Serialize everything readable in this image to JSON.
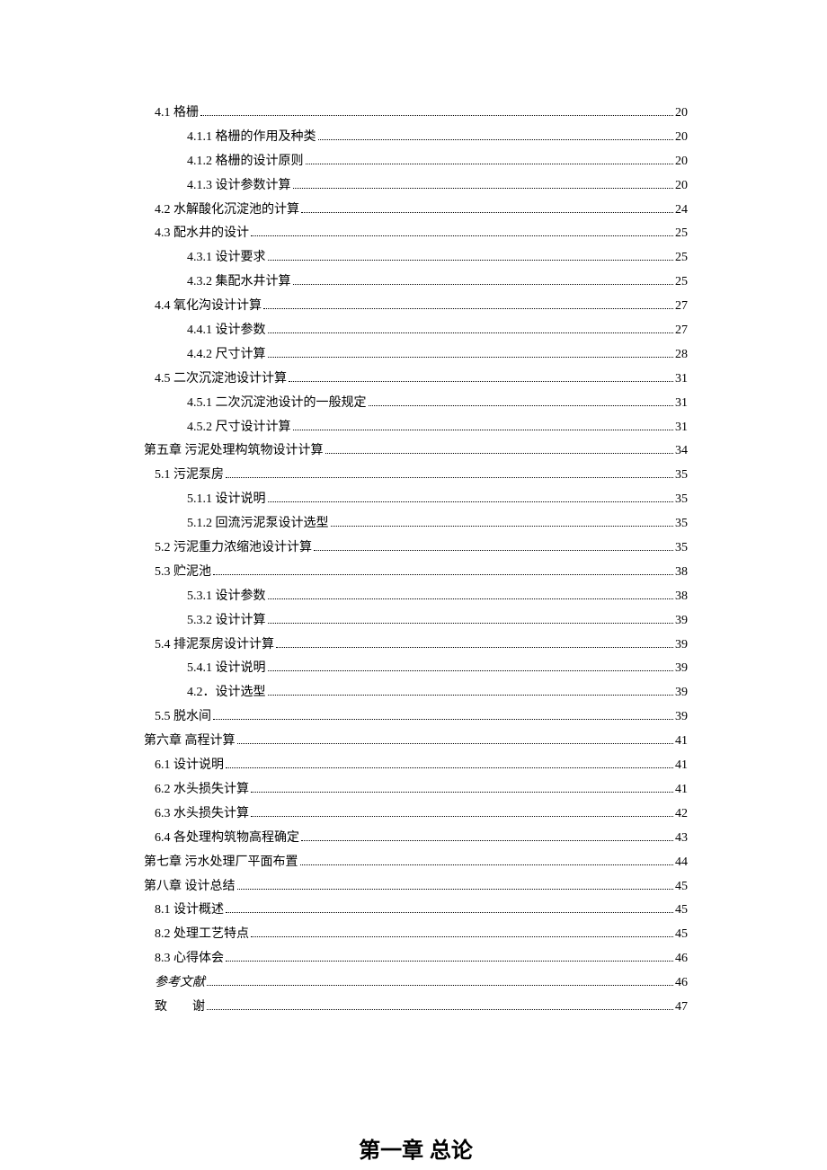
{
  "toc": [
    {
      "level": "l2",
      "label": "4.1 格栅",
      "page": "20"
    },
    {
      "level": "l3",
      "label": "4.1.1 格栅的作用及种类",
      "page": "20"
    },
    {
      "level": "l3",
      "label": "4.1.2 格栅的设计原则",
      "page": "20"
    },
    {
      "level": "l3",
      "label": "4.1.3 设计参数计算",
      "page": "20"
    },
    {
      "level": "l2",
      "label": "4.2 水解酸化沉淀池的计算",
      "page": "24"
    },
    {
      "level": "l2",
      "label": "4.3 配水井的设计",
      "page": "25"
    },
    {
      "level": "l3",
      "label": "4.3.1   设计要求",
      "page": "25"
    },
    {
      "level": "l3",
      "label": "4.3.2   集配水井计算",
      "page": "25"
    },
    {
      "level": "l2",
      "label": "4.4   氧化沟设计计算",
      "page": "27"
    },
    {
      "level": "l3",
      "label": "4.4.1 设计参数",
      "page": "27"
    },
    {
      "level": "l3",
      "label": "4.4.2   尺寸计算",
      "page": "28"
    },
    {
      "level": "l2",
      "label": "4.5   二次沉淀池设计计算",
      "page": "31"
    },
    {
      "level": "l3",
      "label": "4.5.1 二次沉淀池设计的一般规定",
      "page": "31"
    },
    {
      "level": "l3",
      "label": "4.5.2   尺寸设计计算",
      "page": "31"
    },
    {
      "level": "l1",
      "label": "第五章   污泥处理构筑物设计计算",
      "page": "34"
    },
    {
      "level": "l2",
      "label": "5.1 污泥泵房",
      "page": "35"
    },
    {
      "level": "l3",
      "label": "5.1.1 设计说明",
      "page": "35"
    },
    {
      "level": "l3",
      "label": "5.1.2 回流污泥泵设计选型",
      "page": "35"
    },
    {
      "level": "l2",
      "label": "5.2 污泥重力浓缩池设计计算",
      "page": "35"
    },
    {
      "level": "l2",
      "label": "5.3 贮泥池",
      "page": "38"
    },
    {
      "level": "l3",
      "label": "5.3.1 设计参数",
      "page": "38"
    },
    {
      "level": "l3",
      "label": "5.3.2 设计计算",
      "page": "39"
    },
    {
      "level": "l2",
      "label": "5.4 排泥泵房设计计算",
      "page": "39"
    },
    {
      "level": "l3",
      "label": "5.4.1 设计说明",
      "page": "39"
    },
    {
      "level": "l3",
      "label": "4.2．设计选型",
      "page": "39"
    },
    {
      "level": "l2",
      "label": "5.5 脱水间",
      "page": "39"
    },
    {
      "level": "l1",
      "label": "第六章 高程计算",
      "page": "41"
    },
    {
      "level": "l2",
      "label": "6.1 设计说明",
      "page": "41"
    },
    {
      "level": "l2",
      "label": "6.2 水头损失计算",
      "page": "41"
    },
    {
      "level": "l2",
      "label": "6.3 水头损失计算",
      "page": "42"
    },
    {
      "level": "l2",
      "label": "6.4 各处理构筑物高程确定",
      "page": "43"
    },
    {
      "level": "l1",
      "label": "第七章 污水处理厂平面布置",
      "page": "44"
    },
    {
      "level": "l1",
      "label": "第八章   设计总结",
      "page": "45"
    },
    {
      "level": "l2",
      "label": "8.1 设计概述",
      "page": "45"
    },
    {
      "level": "l2",
      "label": "8.2 处理工艺特点",
      "page": "45"
    },
    {
      "level": "l2",
      "label": "8.3 心得体会",
      "page": "46"
    },
    {
      "level": "l2",
      "label": "参考文献",
      "page": "46",
      "italic": true
    },
    {
      "level": "l2",
      "label": "致　　谢",
      "page": "47"
    }
  ],
  "chapter_title": "第一章 总论"
}
